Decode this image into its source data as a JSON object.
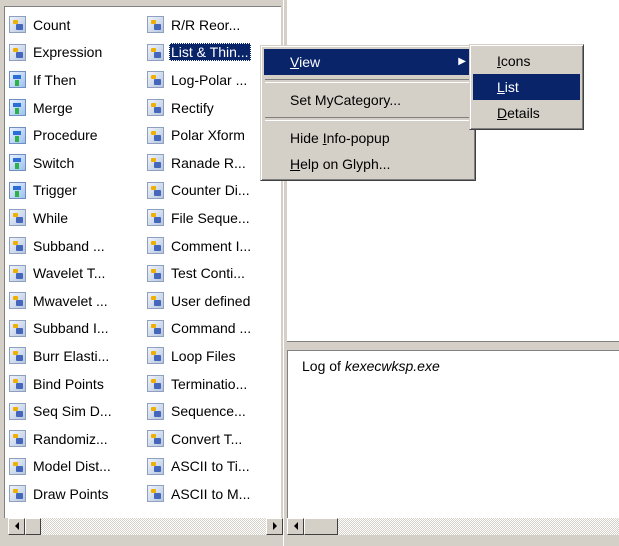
{
  "glyph_list": {
    "column1": [
      {
        "label": "Count",
        "icon": "glyph-icon"
      },
      {
        "label": "Expression",
        "icon": "glyph-icon"
      },
      {
        "label": "If Then",
        "icon": "control-glyph-icon"
      },
      {
        "label": "Merge",
        "icon": "control-glyph-icon"
      },
      {
        "label": "Procedure",
        "icon": "control-glyph-icon"
      },
      {
        "label": "Switch",
        "icon": "control-glyph-icon"
      },
      {
        "label": "Trigger",
        "icon": "control-glyph-icon"
      },
      {
        "label": "While",
        "icon": "glyph-icon"
      },
      {
        "label": "Subband ...",
        "icon": "glyph-icon"
      },
      {
        "label": "Wavelet T...",
        "icon": "glyph-icon"
      },
      {
        "label": "Mwavelet ...",
        "icon": "glyph-icon"
      },
      {
        "label": "Subband I...",
        "icon": "glyph-icon"
      },
      {
        "label": "Burr Elasti...",
        "icon": "glyph-icon"
      },
      {
        "label": "Bind Points",
        "icon": "glyph-icon"
      },
      {
        "label": "Seq Sim D...",
        "icon": "glyph-icon"
      },
      {
        "label": "Randomiz...",
        "icon": "glyph-icon"
      },
      {
        "label": "Model Dist...",
        "icon": "glyph-icon"
      },
      {
        "label": "Draw Points",
        "icon": "glyph-icon"
      }
    ],
    "column2": [
      {
        "label": "R/R Reor...",
        "icon": "glyph-icon"
      },
      {
        "label": "List & Thin...",
        "icon": "glyph-icon",
        "selected": true
      },
      {
        "label": "Log-Polar ...",
        "icon": "glyph-icon"
      },
      {
        "label": "Rectify",
        "icon": "glyph-icon"
      },
      {
        "label": "Polar Xform",
        "icon": "glyph-icon"
      },
      {
        "label": "Ranade R...",
        "icon": "glyph-icon"
      },
      {
        "label": "Counter Di...",
        "icon": "glyph-icon"
      },
      {
        "label": "File Seque...",
        "icon": "glyph-icon"
      },
      {
        "label": "Comment I...",
        "icon": "glyph-icon"
      },
      {
        "label": "Test Conti...",
        "icon": "glyph-icon"
      },
      {
        "label": "User defined",
        "icon": "glyph-icon"
      },
      {
        "label": "Command ...",
        "icon": "glyph-icon"
      },
      {
        "label": "Loop Files",
        "icon": "glyph-icon"
      },
      {
        "label": "Terminatio...",
        "icon": "glyph-icon"
      },
      {
        "label": "Sequence...",
        "icon": "glyph-icon"
      },
      {
        "label": "Convert T...",
        "icon": "glyph-icon"
      },
      {
        "label": "ASCII to Ti...",
        "icon": "glyph-icon"
      },
      {
        "label": "ASCII to M...",
        "icon": "glyph-icon"
      }
    ]
  },
  "context_menu": {
    "view": {
      "pre": "",
      "key": "V",
      "post": "iew"
    },
    "set_category": "Set MyCategory...",
    "hide_info": {
      "pre": "Hide ",
      "key": "I",
      "post": "nfo-popup"
    },
    "help_glyph": {
      "pre": "",
      "key": "H",
      "post": "elp on Glyph..."
    }
  },
  "view_submenu": {
    "icons": {
      "pre": "",
      "key": "I",
      "post": "cons"
    },
    "list": {
      "pre": "",
      "key": "L",
      "post": "ist"
    },
    "details": {
      "pre": "",
      "key": "D",
      "post": "etails"
    }
  },
  "log_panel": {
    "prefix": "Log of ",
    "filename": "kexecwksp.exe"
  },
  "colors": {
    "selection": "#0a246a",
    "face": "#d4d0c8"
  }
}
